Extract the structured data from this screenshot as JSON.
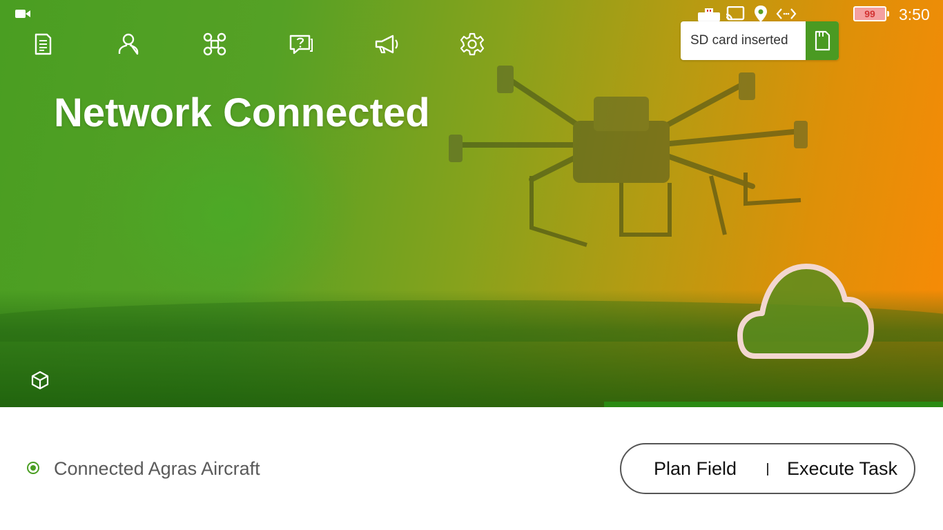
{
  "status_bar": {
    "battery_level": "99",
    "time": "3:50",
    "icons": [
      "video-camera-icon",
      "usb-icon",
      "cast-icon",
      "location-pin-icon",
      "code-arrows-icon",
      "battery-icon"
    ]
  },
  "toolbar": {
    "icons": [
      "document-icon",
      "user-icon",
      "aircraft-icon",
      "help-chat-icon",
      "megaphone-icon",
      "settings-gear-icon"
    ]
  },
  "notification": {
    "text": "SD card inserted",
    "icon": "sd-card-icon"
  },
  "hero": {
    "title": "Network Connected",
    "cloud_button_icon": "cloud-icon",
    "cube_icon": "cube-icon"
  },
  "connection": {
    "label": "Connected Agras Aircraft"
  },
  "actions": {
    "plan_field": "Plan Field",
    "execute_task": "Execute Task"
  },
  "colors": {
    "accent_green": "#4a9e22",
    "accent_orange": "#f98a06",
    "battery_red": "#d23333"
  }
}
